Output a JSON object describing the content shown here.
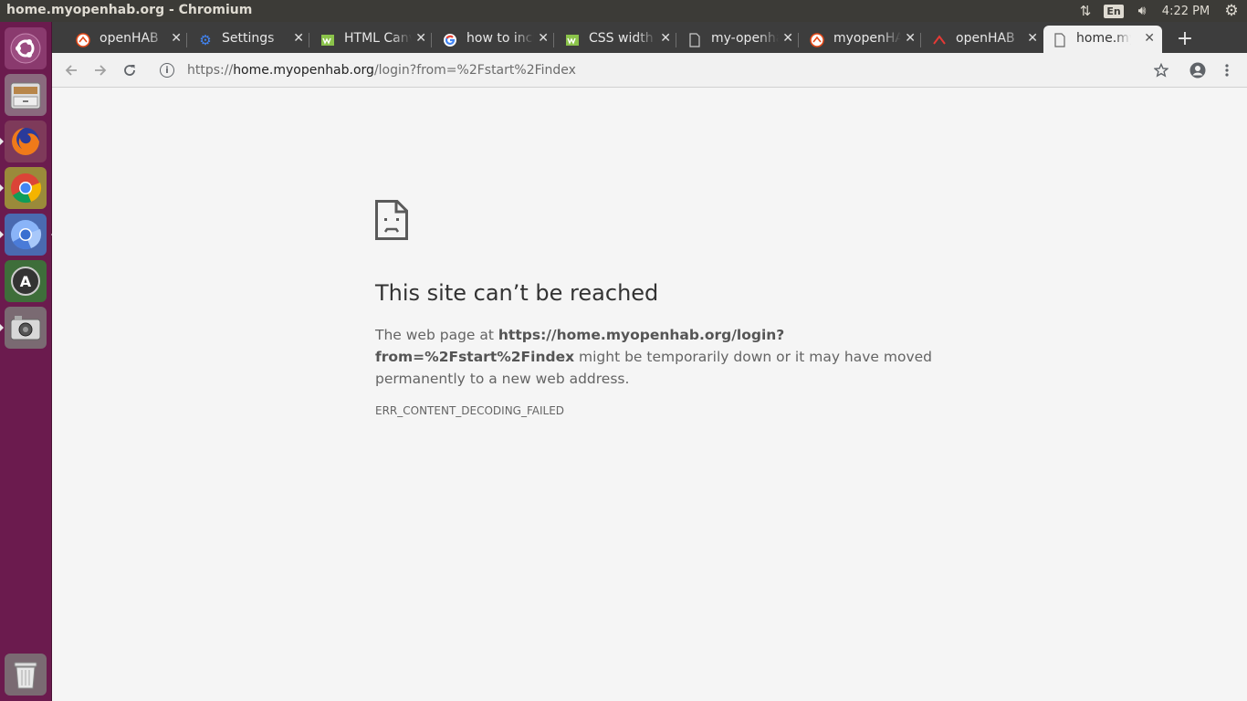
{
  "window": {
    "title": "home.myopenhab.org - Chromium"
  },
  "system_tray": {
    "network_icon": "network-updown-icon",
    "keyboard_layout": "En",
    "volume_icon": "volume-icon",
    "clock": "4:22 PM",
    "session_icon": "gear-icon"
  },
  "launcher": {
    "items": [
      {
        "name": "ubuntu-dash",
        "icon": "ubuntu-logo-icon"
      },
      {
        "name": "files",
        "icon": "file-cabinet-icon"
      },
      {
        "name": "firefox",
        "icon": "firefox-icon"
      },
      {
        "name": "chrome",
        "icon": "chrome-icon"
      },
      {
        "name": "chromium",
        "icon": "chromium-icon"
      },
      {
        "name": "software-updater",
        "icon": "software-updater-icon"
      },
      {
        "name": "camera",
        "icon": "camera-icon"
      },
      {
        "name": "trash",
        "icon": "trash-icon"
      }
    ]
  },
  "tabs": [
    {
      "title": "openHAB",
      "icon": "openhab-icon",
      "active": false
    },
    {
      "title": "Settings",
      "icon": "gear-icon",
      "active": false
    },
    {
      "title": "HTML Canvas",
      "icon": "w3schools-icon",
      "active": false
    },
    {
      "title": "how to include",
      "icon": "google-icon",
      "active": false
    },
    {
      "title": "CSS width",
      "icon": "w3schools-icon",
      "active": false
    },
    {
      "title": "my-openhab",
      "icon": "document-icon",
      "active": false
    },
    {
      "title": "myopenHAB",
      "icon": "openhab-icon",
      "active": false
    },
    {
      "title": "openHAB",
      "icon": "openhab-red-icon",
      "active": false
    },
    {
      "title": "home.myopenhab.org",
      "icon": "document-icon",
      "active": true
    }
  ],
  "new_tab_label": "+",
  "toolbar": {
    "back_icon": "arrow-left-icon",
    "forward_icon": "arrow-right-icon",
    "reload_icon": "reload-icon",
    "star_icon": "star-icon",
    "profile_icon": "profile-icon",
    "menu_icon": "kebab-menu-icon"
  },
  "address_bar": {
    "scheme": "https://",
    "host": "home.myopenhab.org",
    "path": "/login?from=%2Fstart%2Findex"
  },
  "error_page": {
    "icon": "sad-document-icon",
    "heading": "This site can’t be reached",
    "desc_prefix": "The web page at ",
    "url_bold": "https://home.myopenhab.org/login?from=%2Fstart%2Findex",
    "desc_suffix": " might be temporarily down or it may have moved permanently to a new web address.",
    "error_code": "ERR_CONTENT_DECODING_FAILED"
  }
}
